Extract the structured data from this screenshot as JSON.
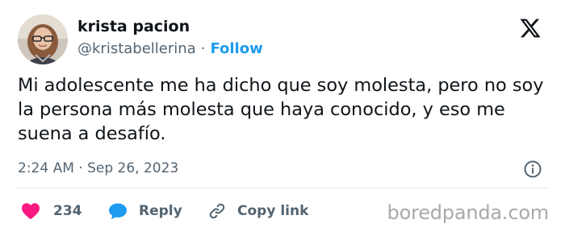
{
  "author": {
    "display_name": "krista pacion",
    "handle": "@kristabellerina",
    "separator": "·",
    "follow_label": "Follow"
  },
  "tweet": {
    "text": "Mi adolescente me ha dicho que soy molesta, pero no soy la persona más molesta que haya conocido, y eso me suena a desafío.",
    "timestamp": "2:24 AM · Sep 26, 2023"
  },
  "actions": {
    "like_count": "234",
    "reply_label": "Reply",
    "copy_link_label": "Copy link"
  },
  "icons": {
    "logo": "x-logo-icon",
    "info": "info-icon",
    "like": "heart-icon",
    "reply": "speech-bubble-icon",
    "copy_link": "link-icon"
  },
  "colors": {
    "accent": "#1d9bf0",
    "like": "#f91880",
    "secondary_text": "#536471",
    "watermark": "#a9a9a9"
  },
  "watermark": "boredpanda.com"
}
